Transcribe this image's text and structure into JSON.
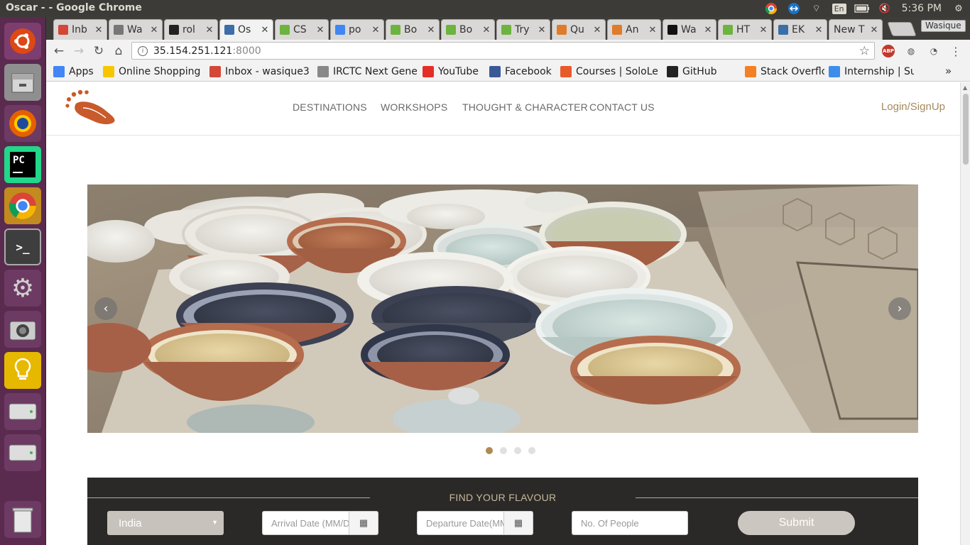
{
  "os": {
    "window_title": "Oscar - - Google Chrome",
    "keyboard_layout": "En",
    "clock": "5:36 PM"
  },
  "launcher": {
    "items": [
      "ubuntu-dash",
      "files",
      "firefox",
      "pycharm",
      "chrome",
      "terminal",
      "system-settings",
      "camera",
      "notes",
      "drive",
      "drive",
      "trash"
    ]
  },
  "tabs": [
    {
      "label": "Inb",
      "icon": "gmail-icon",
      "color": "#d44638"
    },
    {
      "label": "Wa",
      "icon": "document-icon",
      "color": "#777777"
    },
    {
      "label": "rol",
      "icon": "github-icon",
      "color": "#222222"
    },
    {
      "label": "Os",
      "icon": "oval-icon",
      "color": "#3c6ea8",
      "active": true
    },
    {
      "label": "CS",
      "icon": "w3-icon",
      "color": "#6db33f"
    },
    {
      "label": "po",
      "icon": "google-icon",
      "color": "#4285f4"
    },
    {
      "label": "Bo",
      "icon": "w3-icon",
      "color": "#6db33f"
    },
    {
      "label": "Bo",
      "icon": "w3-icon",
      "color": "#6db33f"
    },
    {
      "label": "Try",
      "icon": "w3-icon",
      "color": "#6db33f"
    },
    {
      "label": "Qu",
      "icon": "box-icon",
      "color": "#e07b2a"
    },
    {
      "label": "An",
      "icon": "box-icon",
      "color": "#e07b2a"
    },
    {
      "label": "Wa",
      "icon": "pycharm-icon",
      "color": "#111111"
    },
    {
      "label": "HT",
      "icon": "w3-icon",
      "color": "#6db33f"
    },
    {
      "label": "EK",
      "icon": "oval-icon",
      "color": "#3c6ea8"
    },
    {
      "label": "New T",
      "icon": "",
      "color": ""
    }
  ],
  "profile": "Wasique",
  "omnibox": {
    "host": "35.154.251.121",
    "port": ":8000"
  },
  "extensions": [
    "ABP",
    "bulb-icon",
    "gauge-icon",
    "menu-icon"
  ],
  "bookmarks": [
    {
      "label": "Apps",
      "icon": "apps-grid-icon",
      "color": "#4285f4"
    },
    {
      "label": "Online Shopping",
      "icon": "flipkart-icon",
      "color": "#f7c600"
    },
    {
      "label": "Inbox - wasique3",
      "icon": "gmail-icon",
      "color": "#d44638"
    },
    {
      "label": "IRCTC Next Gene",
      "icon": "document-icon",
      "color": "#888888"
    },
    {
      "label": "YouTube",
      "icon": "youtube-icon",
      "color": "#e52d27"
    },
    {
      "label": "Facebook",
      "icon": "facebook-icon",
      "color": "#3b5998"
    },
    {
      "label": "Courses | SoloLe",
      "icon": "sololearn-icon",
      "color": "#e8592b"
    },
    {
      "label": "GitHub",
      "icon": "github-icon",
      "color": "#222222"
    },
    {
      "label": "Stack Overflow",
      "icon": "stackoverflow-icon",
      "color": "#f48024"
    },
    {
      "label": "Internship | Sum",
      "icon": "internshala-icon",
      "color": "#3d8ee8"
    }
  ],
  "bookmarks_overflow": "»",
  "site": {
    "nav": [
      "DESTINATIONS",
      "WORKSHOPS",
      "THOUGHT & CHARACTER",
      "CONTACT US"
    ],
    "login": "Login/SignUp",
    "carousel": {
      "prev": "‹",
      "next": "›",
      "active_slide": 1,
      "slide_count": 4
    },
    "search": {
      "title": "FIND YOUR FLAVOUR",
      "country": "India",
      "arrival_placeholder": "Arrival Date (MM/DD/YYYY)",
      "departure_placeholder": "Departure Date(MM/DD/YYYY)",
      "people_placeholder": "No. Of People",
      "submit": "Submit"
    }
  }
}
